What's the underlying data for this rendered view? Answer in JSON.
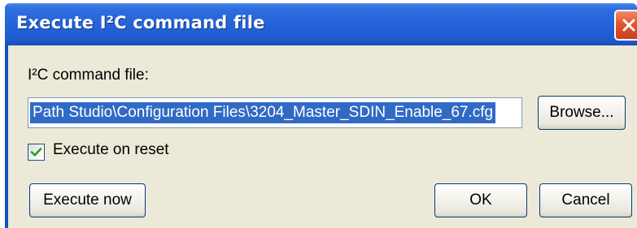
{
  "window": {
    "title": "Execute I²C command file",
    "close_icon": "close-icon"
  },
  "form": {
    "file_label": "I²C command file:",
    "file_path_value": "Path Studio\\Configuration Files\\3204_Master_SDIN_Enable_67.cfg",
    "browse_label": "Browse...",
    "execute_on_reset_label": "Execute on reset",
    "execute_on_reset_checked": true
  },
  "buttons": {
    "execute_now": "Execute now",
    "ok": "OK",
    "cancel": "Cancel"
  },
  "colors": {
    "titlebar": "#2563d9",
    "selection": "#316ac5",
    "dialog_background": "#ece9d8",
    "close_button": "#e0562f",
    "checkmark": "#21a121"
  }
}
